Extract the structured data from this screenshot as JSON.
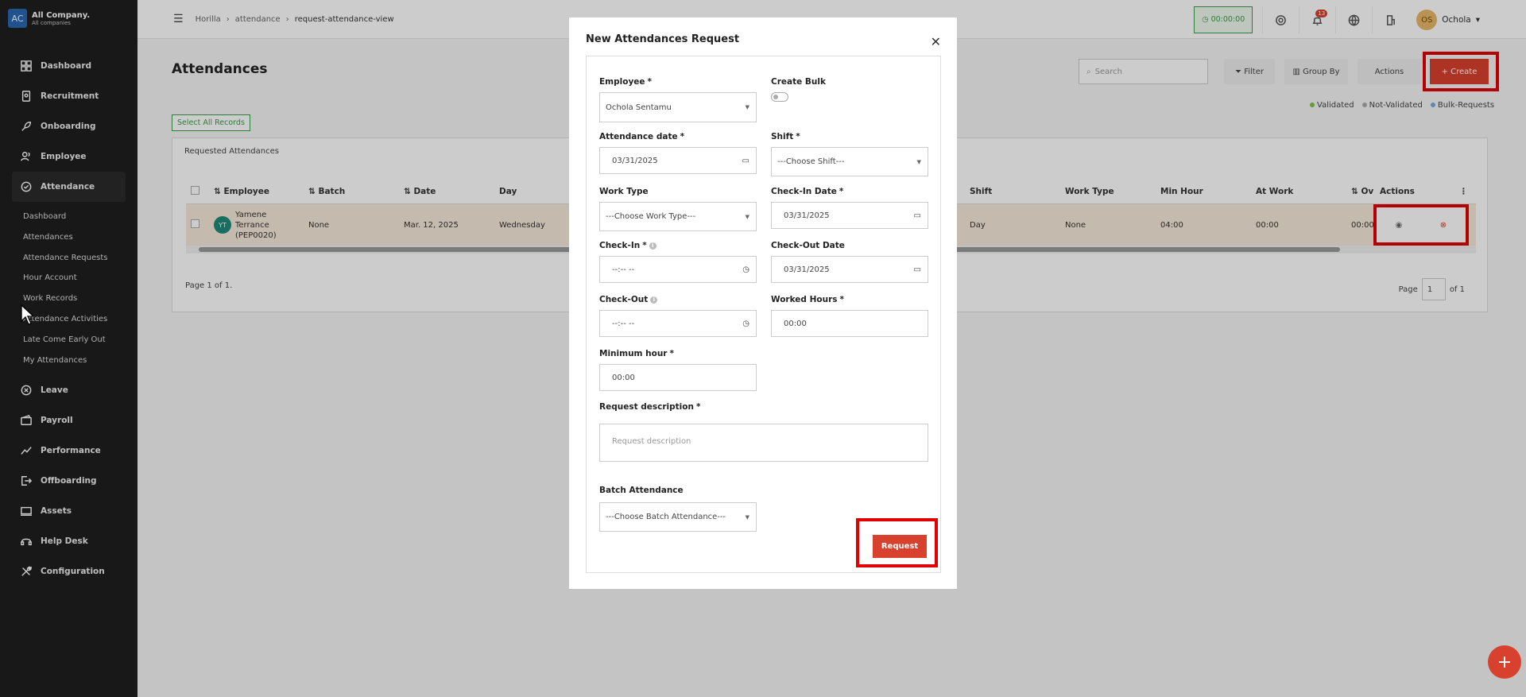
{
  "company": {
    "logo": "AC",
    "name": "All Company.",
    "sub": "All companies"
  },
  "sidebar": {
    "items": [
      {
        "label": "Dashboard",
        "icon": "dashboard-icon"
      },
      {
        "label": "Recruitment",
        "icon": "recruitment-icon"
      },
      {
        "label": "Onboarding",
        "icon": "onboarding-icon"
      },
      {
        "label": "Employee",
        "icon": "employee-icon"
      },
      {
        "label": "Attendance",
        "icon": "attendance-icon"
      },
      {
        "label": "Leave",
        "icon": "leave-icon"
      },
      {
        "label": "Payroll",
        "icon": "payroll-icon"
      },
      {
        "label": "Performance",
        "icon": "performance-icon"
      },
      {
        "label": "Offboarding",
        "icon": "offboarding-icon"
      },
      {
        "label": "Assets",
        "icon": "assets-icon"
      },
      {
        "label": "Help Desk",
        "icon": "helpdesk-icon"
      },
      {
        "label": "Configuration",
        "icon": "configuration-icon"
      }
    ],
    "attendance_sub": [
      "Dashboard",
      "Attendances",
      "Attendance Requests",
      "Hour Account",
      "Work Records",
      "Attendance Activities",
      "Late Come Early Out",
      "My Attendances"
    ]
  },
  "header": {
    "breadcrumb": [
      "Horilla",
      "attendance",
      "request-attendance-view"
    ],
    "timer": "00:00:00",
    "notifications": "13",
    "user_initials": "OS",
    "user_name": "Ochola"
  },
  "main": {
    "title": "Attendances",
    "search_placeholder": "Search",
    "filter": "Filter",
    "group_by": "Group By",
    "actions": "Actions",
    "create": "+ Create",
    "legend": [
      "Validated",
      "Not-Validated",
      "Bulk-Requests"
    ],
    "legend_colors": [
      "#7cc242",
      "#aaaaaa",
      "#7aa7e0"
    ],
    "select_all": "Select All Records",
    "panel_title": "Requested Attendances",
    "columns": [
      "Employee",
      "Batch",
      "Date",
      "Day",
      "Shift",
      "Work Type",
      "Min Hour",
      "At Work",
      "Ov",
      "Actions"
    ],
    "row": {
      "initials": "YT",
      "employee": "Yamene Terrance (PEP0020)",
      "batch": "None",
      "date": "Mar. 12, 2025",
      "day": "Wednesday",
      "shift": "Day",
      "work_type": "None",
      "min_hour": "04:00",
      "at_work": "00:00",
      "ov": "00:00"
    },
    "page_info": "Page 1 of 1.",
    "page_label": "Page",
    "page_value": "1",
    "page_of": "of 1"
  },
  "modal": {
    "title": "New Attendances Request",
    "employee_label": "Employee",
    "employee_value": "Ochola Sentamu",
    "create_bulk_label": "Create Bulk",
    "attendance_date_label": "Attendance date",
    "attendance_date_value": "03/31/2025",
    "shift_label": "Shift",
    "shift_value": "---Choose Shift---",
    "work_type_label": "Work Type",
    "work_type_value": "---Choose Work Type---",
    "checkin_date_label": "Check-In Date",
    "checkin_date_value": "03/31/2025",
    "checkin_label": "Check-In",
    "checkin_value": "--:-- --",
    "checkout_date_label": "Check-Out Date",
    "checkout_date_value": "03/31/2025",
    "checkout_label": "Check-Out",
    "checkout_value": "--:-- --",
    "worked_hours_label": "Worked Hours",
    "worked_hours_value": "00:00",
    "min_hour_label": "Minimum hour",
    "min_hour_value": "00:00",
    "desc_label": "Request description",
    "desc_placeholder": "Request description",
    "batch_label": "Batch Attendance",
    "batch_value": "---Choose Batch Attendance---",
    "request_button": "Request"
  }
}
